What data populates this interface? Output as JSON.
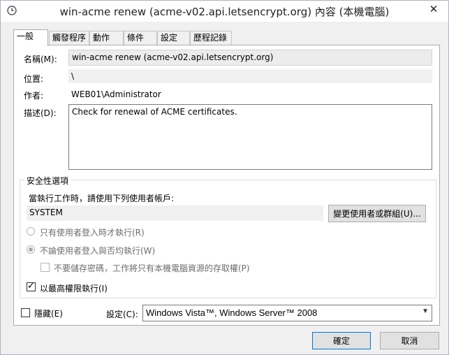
{
  "window": {
    "title": "win-acme renew (acme-v02.api.letsencrypt.org) 內容 (本機電腦)",
    "close_symbol": "✕",
    "app_icon": "clock-icon"
  },
  "tabs": [
    {
      "label": "一般",
      "active": true
    },
    {
      "label": "觸發程序",
      "active": false
    },
    {
      "label": "動作",
      "active": false
    },
    {
      "label": "條件",
      "active": false
    },
    {
      "label": "設定",
      "active": false
    },
    {
      "label": "歷程記錄",
      "active": false
    }
  ],
  "general": {
    "name_label": "名稱(M):",
    "name_value": "win-acme renew (acme-v02.api.letsencrypt.org)",
    "location_label": "位置:",
    "location_value": "\\",
    "author_label": "作者:",
    "author_value": "WEB01\\Administrator",
    "description_label": "描述(D):",
    "description_value": "Check for renewal of ACME certificates."
  },
  "security": {
    "group_title": "安全性選項",
    "run_as_label": "當執行工作時，請使用下列使用者帳戶:",
    "run_as_value": "SYSTEM",
    "change_user_button": "變更使用者或群組(U)...",
    "radio_logged_on": "只有使用者登入時才執行(R)",
    "radio_whether": "不論使用者登入與否均執行(W)",
    "no_store_password": "不要儲存密碼，工作將只有本機電腦資源的存取權(P)",
    "highest_privileges": "以最高權限執行(I)"
  },
  "bottom": {
    "hidden_label": "隱藏(E)",
    "configure_label": "設定(C):",
    "configure_value": "Windows Vista™, Windows Server™ 2008",
    "ok_button": "確定",
    "cancel_button": "取消"
  }
}
